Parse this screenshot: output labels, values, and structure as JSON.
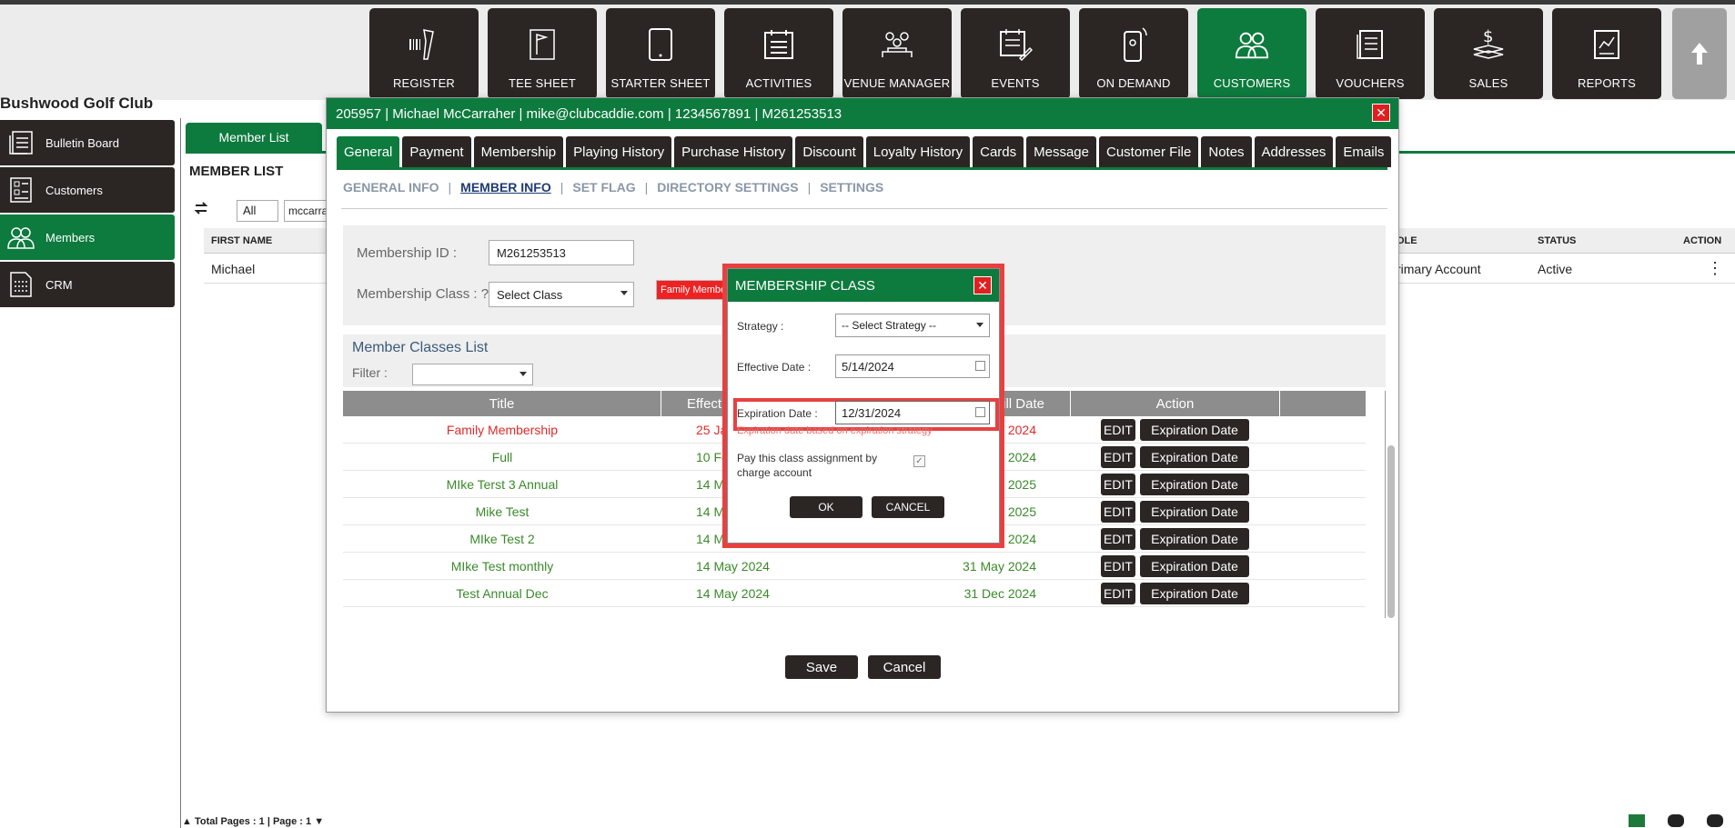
{
  "club_name": "Bushwood Golf Club",
  "colors": {
    "brand_green": "#0d7a3e",
    "nav_dark": "#2b2623",
    "alert_red": "#e84040"
  },
  "nav": {
    "items": [
      {
        "label": "REGISTER",
        "icon": "barcode-scanner-icon"
      },
      {
        "label": "TEE SHEET",
        "icon": "flag-sheet-icon"
      },
      {
        "label": "STARTER SHEET",
        "icon": "tablet-icon"
      },
      {
        "label": "ACTIVITIES",
        "icon": "calendar-list-icon"
      },
      {
        "label": "VENUE MANAGER",
        "icon": "venue-people-icon"
      },
      {
        "label": "EVENTS",
        "icon": "calendar-edit-icon"
      },
      {
        "label": "ON DEMAND",
        "icon": "mobile-icon"
      },
      {
        "label": "CUSTOMERS",
        "icon": "people-icon",
        "active": true
      },
      {
        "label": "VOUCHERS",
        "icon": "voucher-icon"
      },
      {
        "label": "SALES",
        "icon": "dollar-icon"
      },
      {
        "label": "REPORTS",
        "icon": "report-icon"
      }
    ],
    "up_icon": "arrow-up-icon"
  },
  "sidebar": {
    "items": [
      {
        "label": "Bulletin Board"
      },
      {
        "label": "Customers"
      },
      {
        "label": "Members",
        "active": true
      },
      {
        "label": "CRM"
      }
    ]
  },
  "main": {
    "tab": "Member List",
    "heading": "MEMBER LIST",
    "filter_value": "All",
    "search_value": "mccarra",
    "columns": {
      "first_name": "FIRST NAME",
      "role": "OLE",
      "status": "STATUS",
      "action": "ACTION"
    },
    "row": {
      "first_name": "Michael",
      "role": "rimary Account",
      "status": "Active",
      "action": "⋮"
    },
    "footer": "Total Pages : 1 | Page : 1"
  },
  "customer_modal": {
    "title": "205957 | Michael McCarraher | mike@clubcaddie.com | 1234567891 | M261253513",
    "tabs": [
      "General",
      "Payment",
      "Membership",
      "Playing History",
      "Purchase History",
      "Discount",
      "Loyalty History",
      "Cards",
      "Message",
      "Customer File",
      "Notes",
      "Addresses",
      "Emails"
    ],
    "active_tab": "General",
    "subnav": [
      "GENERAL INFO",
      "MEMBER INFO",
      "SET FLAG",
      "DIRECTORY SETTINGS",
      "SETTINGS"
    ],
    "subnav_separator": "|",
    "membership_id_label": "Membership ID :",
    "membership_id": "M261253513",
    "membership_class_label": "Membership Class : ?",
    "membership_class_select": "Select Class",
    "class_tag": "Family Members",
    "classes_list_title": "Member Classes List",
    "filter_label": "Filter :",
    "table_headers": {
      "title": "Title",
      "effective": "Effect",
      "till": "ill Date",
      "action": "Action"
    },
    "rows": [
      {
        "title": "Family Membership",
        "effective": "25 Ja",
        "till": "2024",
        "red": true
      },
      {
        "title": "Full",
        "effective": "10 Fe",
        "till": "y 2024"
      },
      {
        "title": "MIke Terst 3 Annual",
        "effective": "14 M",
        "till": "y 2025"
      },
      {
        "title": "Mike Test",
        "effective": "14 M",
        "till": "y 2025"
      },
      {
        "title": "MIke Test 2",
        "effective": "14 M",
        "till": "2024"
      },
      {
        "title": "MIke Test monthly",
        "effective": "14 May 2024",
        "till": "31 May 2024"
      },
      {
        "title": "Test Annual Dec",
        "effective": "14 May 2024",
        "till": "31 Dec 2024"
      }
    ],
    "edit_label": "EDIT",
    "expiration_label": "Expiration Date",
    "save": "Save",
    "cancel": "Cancel"
  },
  "membership_class_dialog": {
    "title": "MEMBERSHIP CLASS",
    "strategy_label": "Strategy :",
    "strategy_value": "-- Select Strategy --",
    "effective_label": "Effective Date :",
    "effective_value": "5/14/2024",
    "expiration_label": "Expiration Date :",
    "expiration_value": "12/31/2024",
    "expiration_note": "Expiration date based on expiration strategy",
    "pay_label": "Pay this class assignment by charge account",
    "pay_checked": true,
    "ok": "OK",
    "cancel": "CANCEL"
  }
}
